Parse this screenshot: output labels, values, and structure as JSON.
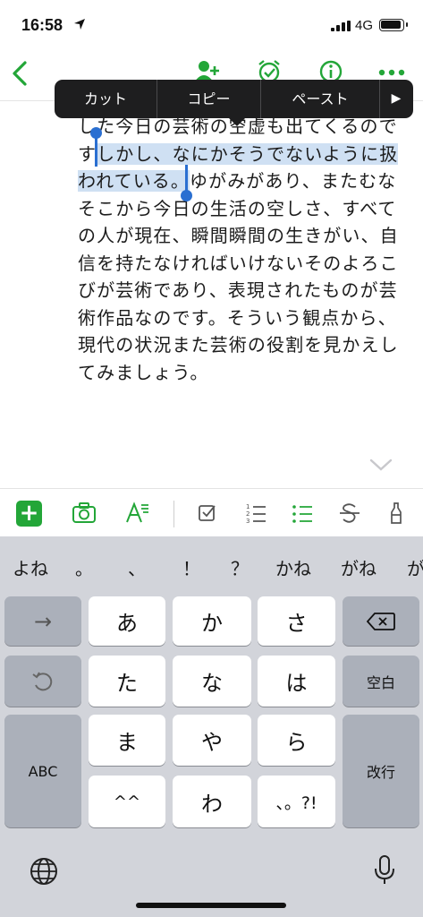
{
  "status_bar": {
    "time": "16:58",
    "network": "4G"
  },
  "note": {
    "lines": [
      "した今日の芸術の空虚も出てくるので",
      "すしかし、なにかそうでないように扱",
      "われている。ゆがみがあり、またむな",
      "そこから今日の生活の空しさ、すべて",
      "の人が現在、瞬間瞬間の生きがい、自",
      "信を持たなければいけないそのよろこ",
      "びが芸術であり、表現されたものが芸",
      "術作品なのです。そういう観点から、",
      "現代の状況また芸術の役割を見かえし",
      "てみましょう。"
    ],
    "selected_line2": "しかし、なにかそうでないように扱",
    "selected_line3": "われている。",
    "line2_prefix": "す",
    "line3_suffix": "ゆがみがあり、またむな"
  },
  "context_menu": {
    "cut": "カット",
    "copy": "コピー",
    "paste": "ペースト",
    "more": "▶"
  },
  "keyboard": {
    "candidates": [
      "よね",
      "。",
      "、",
      "！",
      "？",
      "かね",
      "がね",
      "が"
    ],
    "rows": {
      "r1": [
        "→",
        "あ",
        "か",
        "さ"
      ],
      "r2": [
        "た",
        "な",
        "は",
        "空白"
      ],
      "r3": [
        "ABC",
        "ま",
        "や",
        "ら",
        "改行"
      ],
      "r4": [
        "^^",
        "わ",
        "、。?!"
      ]
    }
  },
  "colors": {
    "accent": "#23a638",
    "selection": "#cfe0f3",
    "handle": "#2a6fd1"
  }
}
